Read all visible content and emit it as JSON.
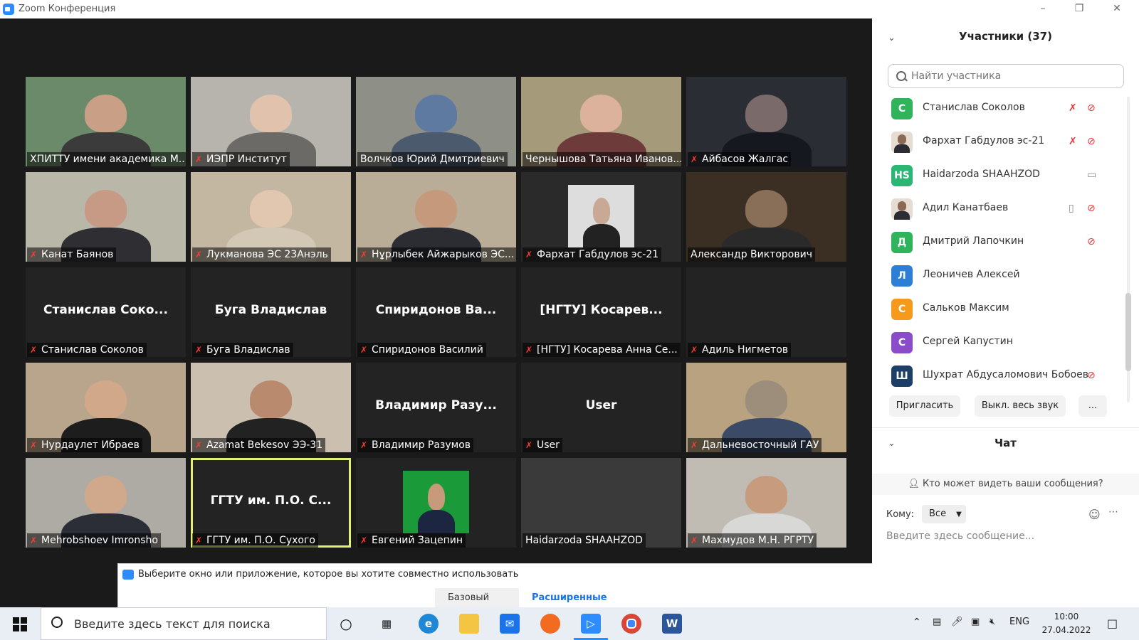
{
  "window": {
    "title": "Zoom Конференция"
  },
  "tiles": [
    {
      "label": "ХПИТТУ имени академика М...",
      "muted": false,
      "bg": "#6b8a6a",
      "face": "#c9a086",
      "body": "#3b3b3b",
      "cam": true
    },
    {
      "label": "ИЭПР Институт",
      "muted": true,
      "bg": "#b7b4ad",
      "face": "#e0c2ad",
      "body": "#6b6a66",
      "cam": true
    },
    {
      "label": "Волчков Юрий Дмитриевич",
      "muted": false,
      "bg": "#8e8f86",
      "face": "#5e7aa0",
      "body": "#4b5a6c",
      "cam": true
    },
    {
      "label": "Чернышова Татьяна Иванов...",
      "muted": false,
      "bg": "#a59a79",
      "face": "#dcb29c",
      "body": "#6e3b3b",
      "cam": true
    },
    {
      "label": "Айбасов Жалгас",
      "muted": true,
      "bg": "#2a2d33",
      "face": "#7a6a6a",
      "body": "#161820",
      "cam": true
    },
    {
      "label": "Канат Баянов",
      "muted": true,
      "bg": "#b9b7a8",
      "face": "#c69a84",
      "body": "#2f2f33",
      "cam": true
    },
    {
      "label": "Лукманова ЭС 23Анэль",
      "muted": true,
      "bg": "#c4b7a2",
      "face": "#e2c7b0",
      "body": "#d3c7b6",
      "cam": true
    },
    {
      "label": "Нұрлыбек Айжарыков ЭС...",
      "muted": true,
      "bg": "#b9ad98",
      "face": "#c59a7c",
      "body": "#2b2d33",
      "cam": true
    },
    {
      "label": "Фархат Габдулов эс-21",
      "muted": true,
      "bg": "#2a2a2a",
      "face": "#c9a896",
      "body": "#222",
      "cam": true,
      "inset": true
    },
    {
      "label": "Александр Викторович",
      "muted": false,
      "bg": "#3b2f24",
      "face": "#8a6f58",
      "body": "#2a2a2a",
      "cam": true
    },
    {
      "label": "Станислав Соколов",
      "muted": true,
      "big": "Станислав  Соко...",
      "cam": false
    },
    {
      "label": "Буга Владислав",
      "muted": true,
      "big": "Буга Владислав",
      "cam": false
    },
    {
      "label": "Спиридонов Василий",
      "muted": true,
      "big": "Спиридонов  Ва...",
      "cam": false
    },
    {
      "label": "[НГТУ] Косарева Анна Се...",
      "muted": true,
      "big": "[НГТУ]  Косарев...",
      "cam": false
    },
    {
      "label": "Адиль Нигметов",
      "muted": true,
      "big": "",
      "cam": false
    },
    {
      "label": "Нурдаулет Ибраев",
      "muted": true,
      "bg": "#b8a58c",
      "face": "#d2a88a",
      "body": "#1d1d1d",
      "cam": true
    },
    {
      "label": "Azamat Bekesov ЭЭ-31",
      "muted": true,
      "bg": "#cbbfb0",
      "face": "#b98a6e",
      "body": "#222",
      "cam": true
    },
    {
      "label": "Владимир Разумов",
      "muted": true,
      "big": "Владимир  Разу...",
      "cam": false
    },
    {
      "label": "User",
      "muted": true,
      "big": "User",
      "cam": false
    },
    {
      "label": "Дальневосточный ГАУ",
      "muted": true,
      "bg": "#b8a27f",
      "face": "#9c8e7b",
      "body": "#3b4a66",
      "cam": true
    },
    {
      "label": "Mehrobshoev Imronsho",
      "muted": true,
      "bg": "#aeaaa4",
      "face": "#d0a98d",
      "body": "#2b2e36",
      "cam": true
    },
    {
      "label": "ГГТУ им. П.О. Сухого",
      "muted": true,
      "big": "ГГТУ  им.  П.О.  С...",
      "cam": false,
      "active": true
    },
    {
      "label": "Евгений Зацепин",
      "muted": true,
      "bg": "#232323",
      "face": "#c69a7a",
      "body": "#1c2640",
      "cam": true,
      "inset": true,
      "insetbg": "#1b9a3a"
    },
    {
      "label": "Haidarzoda SHAAHZOD",
      "muted": false,
      "big": "",
      "cam": false,
      "dark": "#3a3a3a"
    },
    {
      "label": "Махмудов М.Н. РГРТУ",
      "muted": true,
      "bg": "#c0bcb4",
      "face": "#c79b7e",
      "body": "#d8d8d6",
      "cam": true
    }
  ],
  "share": {
    "text": "Выберите окно или приложение, которое вы хотите совместно использовать",
    "tab_basic": "Базовый",
    "tab_advanced": "Расширенные"
  },
  "panel": {
    "participants_title": "Участники (37)",
    "search_placeholder": "Найти участника",
    "participants": [
      {
        "name": "Станислав Соколов",
        "initial": "С",
        "color": "#2fb35b",
        "mic": "muted",
        "video": "off"
      },
      {
        "name": "Фархат Габдулов эс-21",
        "initial": "",
        "color": "#6a6a6a",
        "photo": true,
        "mic": "muted",
        "video": "off"
      },
      {
        "name": "Haidarzoda SHAAHZOD",
        "initial": "HS",
        "color": "#2bb673",
        "mic": "none",
        "video": "on"
      },
      {
        "name": "Адил Канатбаев",
        "initial": "",
        "color": "#5a5a5a",
        "photo": true,
        "mic": "on",
        "video": "off"
      },
      {
        "name": "Дмитрий Лапочкин",
        "initial": "Д",
        "color": "#2fb35b",
        "mic": "none",
        "video": "off"
      },
      {
        "name": "Леоничев Алексей",
        "initial": "Л",
        "color": "#2d7fd6",
        "mic": "none",
        "video": "none"
      },
      {
        "name": "Сальков Максим",
        "initial": "С",
        "color": "#f59a1b",
        "mic": "none",
        "video": "none"
      },
      {
        "name": "Сергей Капустин",
        "initial": "С",
        "color": "#8a4cc9",
        "mic": "none",
        "video": "none"
      },
      {
        "name": "Шухрат Абдусаломович Бобоев",
        "initial": "Ш",
        "color": "#1d3e66",
        "mic": "none",
        "video": "off"
      }
    ],
    "invite_label": "Пригласить",
    "mute_all_label": "Выкл. весь звук",
    "more_label": "...",
    "chat_title": "Чат",
    "who_can_see": "Кто может видеть ваши сообщения?",
    "to_label": "Кому:",
    "to_value": "Все",
    "chat_placeholder": "Введите здесь сообщение..."
  },
  "taskbar": {
    "search_text": "Введите здесь текст для поиска",
    "lang": "ENG",
    "time": "10:00",
    "date": "27.04.2022"
  }
}
